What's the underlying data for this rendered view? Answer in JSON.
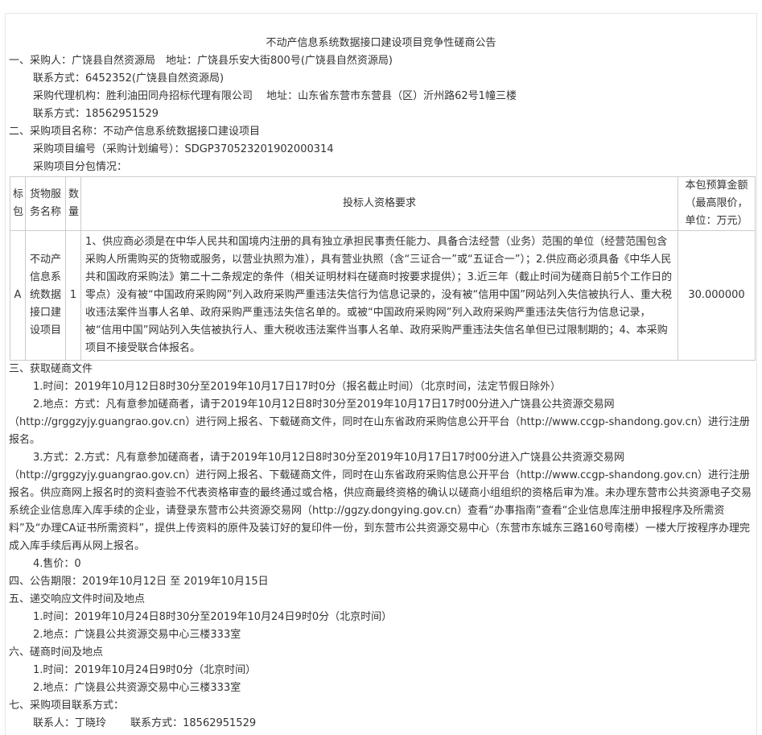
{
  "title": "不动产信息系统数据接口建设项目竞争性磋商公告",
  "s1": {
    "purchaser": "一、采购人：广饶县自然资源局　地址：广饶县乐安大街800号(广饶县自然资源局)",
    "contact1": "联系方式：6452352(广饶县自然资源局)",
    "agency": "采购代理机构：胜利油田同舟招标代理有限公司　 地址：山东省东营市东营县（区）沂州路62号1幢三楼",
    "contact2": "联系方式：18562951529"
  },
  "s2": {
    "name": "二、采购项目名称：不动产信息系统数据接口建设项目",
    "code": "采购项目编号（采购计划编号）：SDGP370523201902000314",
    "lots_label": "采购项目分包情况："
  },
  "table": {
    "headers": {
      "lot": "标包",
      "goods": "货物服务名称",
      "qty": "数量",
      "req": "投标人资格要求",
      "budget": "本包预算金额（最高限价，单位：万元）"
    },
    "row": {
      "lot": "A",
      "goods": "不动产信息系统数据接口建设项目",
      "qty": "1",
      "req": "1、供应商必须是在中华人民共和国境内注册的具有独立承担民事责任能力、具备合法经营（业务）范围的单位（经营范围包含采购人所需购买的货物或服务，以营业执照为准），具有营业执照（含“三证合一”或“五证合一”）；2.供应商必须具备《中华人民共和国政府采购法》第二十二条规定的条件（相关证明材料在磋商时按要求提供）；3.近三年（截止时间为磋商日前5个工作日的零点）没有被“中国政府采购网”列入政府采购严重违法失信行为信息记录的，没有被“信用中国”网站列入失信被执行人、重大税收违法案件当事人名单、政府采购严重违法失信名单的。或被“中国政府采购网”列入政府采购严重违法失信行为信息记录，被“信用中国”网站列入失信被执行人、重大税收违法案件当事人名单、政府采购严重违法失信名单但已过限制期的；4、本采购项目不接受联合体报名。",
      "budget": "30.000000"
    }
  },
  "s3": {
    "heading": "三、获取磋商文件",
    "time": "1.时间：2019年10月12日8时30分至2019年10月17日17时0分（报名截止时间）（北京时间，法定节假日除外）",
    "place": "2.地点：方式：凡有意参加磋商者，请于2019年10月12日8时30分至2019年10月17日17时00分进入广饶县公共资源交易网（http://grggzyjy.guangrao.gov.cn）进行网上报名、下载磋商文件，同时在山东省政府采购信息公开平台（http://www.ccgp-shandong.gov.cn）进行注册报名。",
    "method": "3.方式：2.方式：凡有意参加磋商者，请于2019年10月12日8时30分至2019年10月17日17时00分进入广饶县公共资源交易网（http://grggzyjy.guangrao.gov.cn）进行网上报名、下载磋商文件，同时在山东省政府采购信息公开平台（http://www.ccgp-shandong.gov.cn）进行注册报名。供应商网上报名时的资料查验不代表资格审查的最终通过或合格，供应商最终资格的确认以磋商小组组织的资格后审为准。未办理东营市公共资源电子交易系统企业信息库入库手续的企业，请登录东营市公共资源交易网（http://ggzy.dongying.gov.cn）查看“办事指南”查看“企业信息库注册申报程序及所需资料”及“办理CA证书所需资料”，提供上传资料的原件及装订好的复印件一份，到东营市公共资源交易中心（东营市东城东三路160号南楼）一楼大厅按程序办理完成入库手续后再从网上报名。",
    "price": "4.售价：0"
  },
  "s4": {
    "period": "四、公告期限：2019年10月12日 至 2019年10月15日"
  },
  "s5": {
    "heading": "五、递交响应文件时间及地点",
    "time": "1.时间：2019年10月24日8时30分至2019年10月24日9时0分（北京时间）",
    "place": "2.地点：广饶县公共资源交易中心三楼333室"
  },
  "s6": {
    "heading": "六、磋商时间及地点",
    "time": "1.时间：2019年10月24日9时0分（北京时间）",
    "place": "2.地点：广饶县公共资源交易中心三楼333室"
  },
  "s7": {
    "heading": "七、采购项目联系方式：",
    "contact": "联系人：丁晓玲　　 联系方式：18562951529"
  }
}
